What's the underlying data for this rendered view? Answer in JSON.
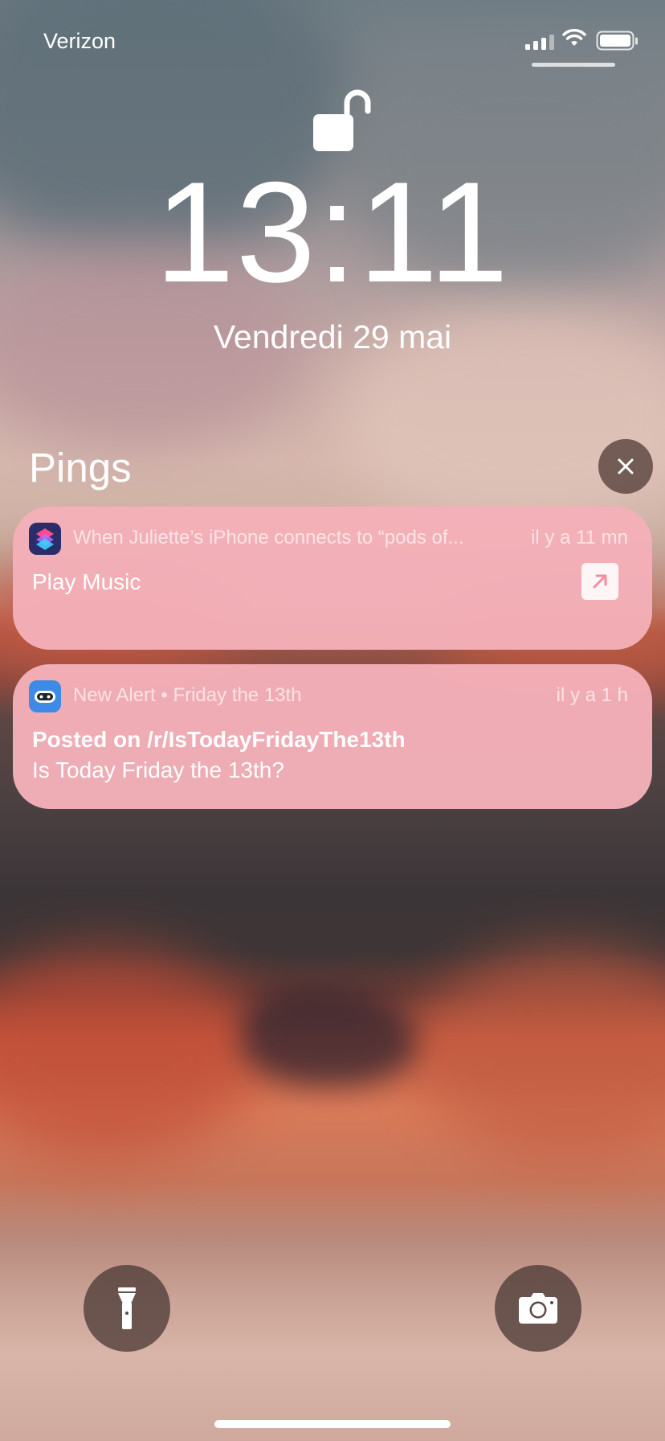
{
  "status_bar": {
    "carrier": "Verizon",
    "icons": [
      "cellular-signal-icon",
      "wifi-icon",
      "battery-icon"
    ]
  },
  "lock_screen": {
    "lock_icon": "unlocked-padlock-icon",
    "time": "13:11",
    "date": "Vendredi 29 mai"
  },
  "notification_group": {
    "title": "Pings",
    "clear_icon": "close-icon"
  },
  "notifications": [
    {
      "app_icon": "shortcuts-app-icon",
      "header": "When Juliette’s iPhone connects to “pods of...",
      "time": "il y a 11 mn",
      "body": "Play Music",
      "action_icon": "open-arrow-icon"
    },
    {
      "app_icon": "bot-app-icon",
      "header": "New Alert • Friday the 13th",
      "time": "il y a 1 h",
      "title": "Posted on /r/IsTodayFridayThe13th",
      "body": "Is Today Friday the 13th?"
    }
  ],
  "quick_actions": {
    "left_icon": "flashlight-icon",
    "right_icon": "camera-icon"
  },
  "colors": {
    "notification_bg": "#F4AFB8",
    "text": "#FFFFFF"
  }
}
